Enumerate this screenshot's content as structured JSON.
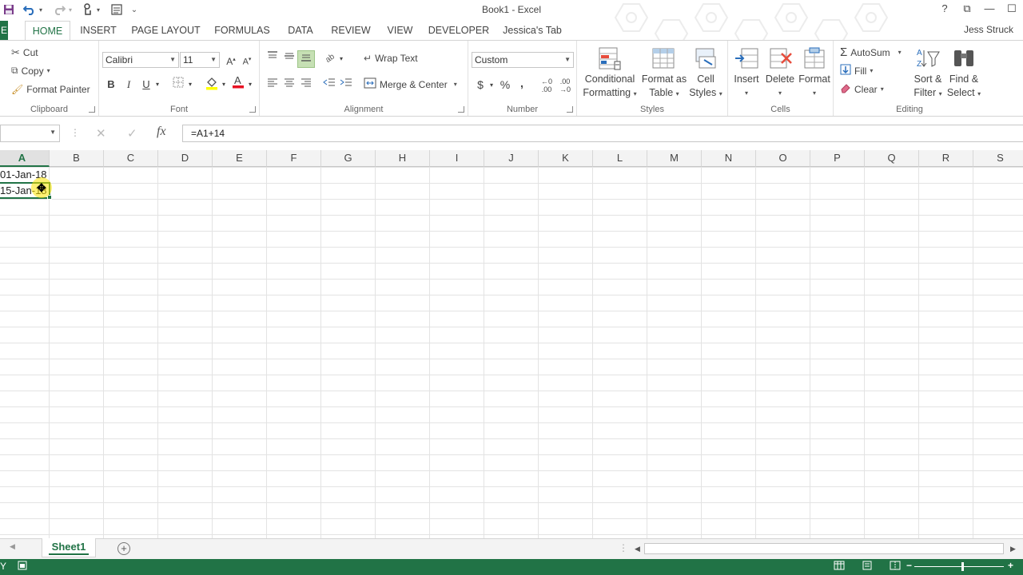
{
  "window": {
    "title": "Book1 - Excel",
    "controls": [
      "?",
      "⧉",
      "—",
      "☐"
    ]
  },
  "qat": [
    "save-icon",
    "undo-icon",
    "redo-icon",
    "touch-mode-icon",
    "customize-qat-icon"
  ],
  "tabs": {
    "file": "E",
    "items": [
      "HOME",
      "INSERT",
      "PAGE LAYOUT",
      "FORMULAS",
      "DATA",
      "REVIEW",
      "VIEW",
      "DEVELOPER",
      "Jessica's Tab"
    ],
    "active": "HOME",
    "user": "Jess Struck"
  },
  "ribbon": {
    "clipboard": {
      "label": "Clipboard",
      "cut": "Cut",
      "copy": "Copy",
      "format_painter": "Format Painter"
    },
    "font": {
      "label": "Font",
      "font_name": "Calibri",
      "font_size": "11",
      "bold": "B",
      "italic": "I",
      "underline": "U"
    },
    "alignment": {
      "label": "Alignment",
      "wrap_text": "Wrap Text",
      "merge_center": "Merge & Center"
    },
    "number": {
      "label": "Number",
      "format": "Custom",
      "currency": "$",
      "percent": "%",
      "comma": ","
    },
    "styles": {
      "label": "Styles",
      "conditional": [
        "Conditional",
        "Formatting"
      ],
      "format_table": [
        "Format as",
        "Table"
      ],
      "cell_styles": [
        "Cell",
        "Styles"
      ]
    },
    "cells": {
      "label": "Cells",
      "insert": "Insert",
      "delete": "Delete",
      "format": "Format"
    },
    "editing": {
      "label": "Editing",
      "autosum": "AutoSum",
      "fill": "Fill",
      "clear": "Clear",
      "sort_filter": [
        "Sort &",
        "Filter"
      ],
      "find_select": [
        "Find &",
        "Select"
      ]
    }
  },
  "formula_bar": {
    "name_box": "",
    "formula": "=A1+14",
    "fx": "fx"
  },
  "grid": {
    "columns": [
      "A",
      "B",
      "C",
      "D",
      "E",
      "F",
      "G",
      "H",
      "I",
      "J",
      "K",
      "L",
      "M",
      "N",
      "O",
      "P",
      "Q",
      "R",
      "S"
    ],
    "selected_column": "A",
    "cells": {
      "A1": "01-Jan-18",
      "A2": "15-Jan-18"
    }
  },
  "sheets": {
    "active": "Sheet1",
    "add": "+"
  },
  "status": {
    "left": "Y"
  },
  "colors": {
    "accent": "#217346",
    "highlight": "#ffe600"
  }
}
